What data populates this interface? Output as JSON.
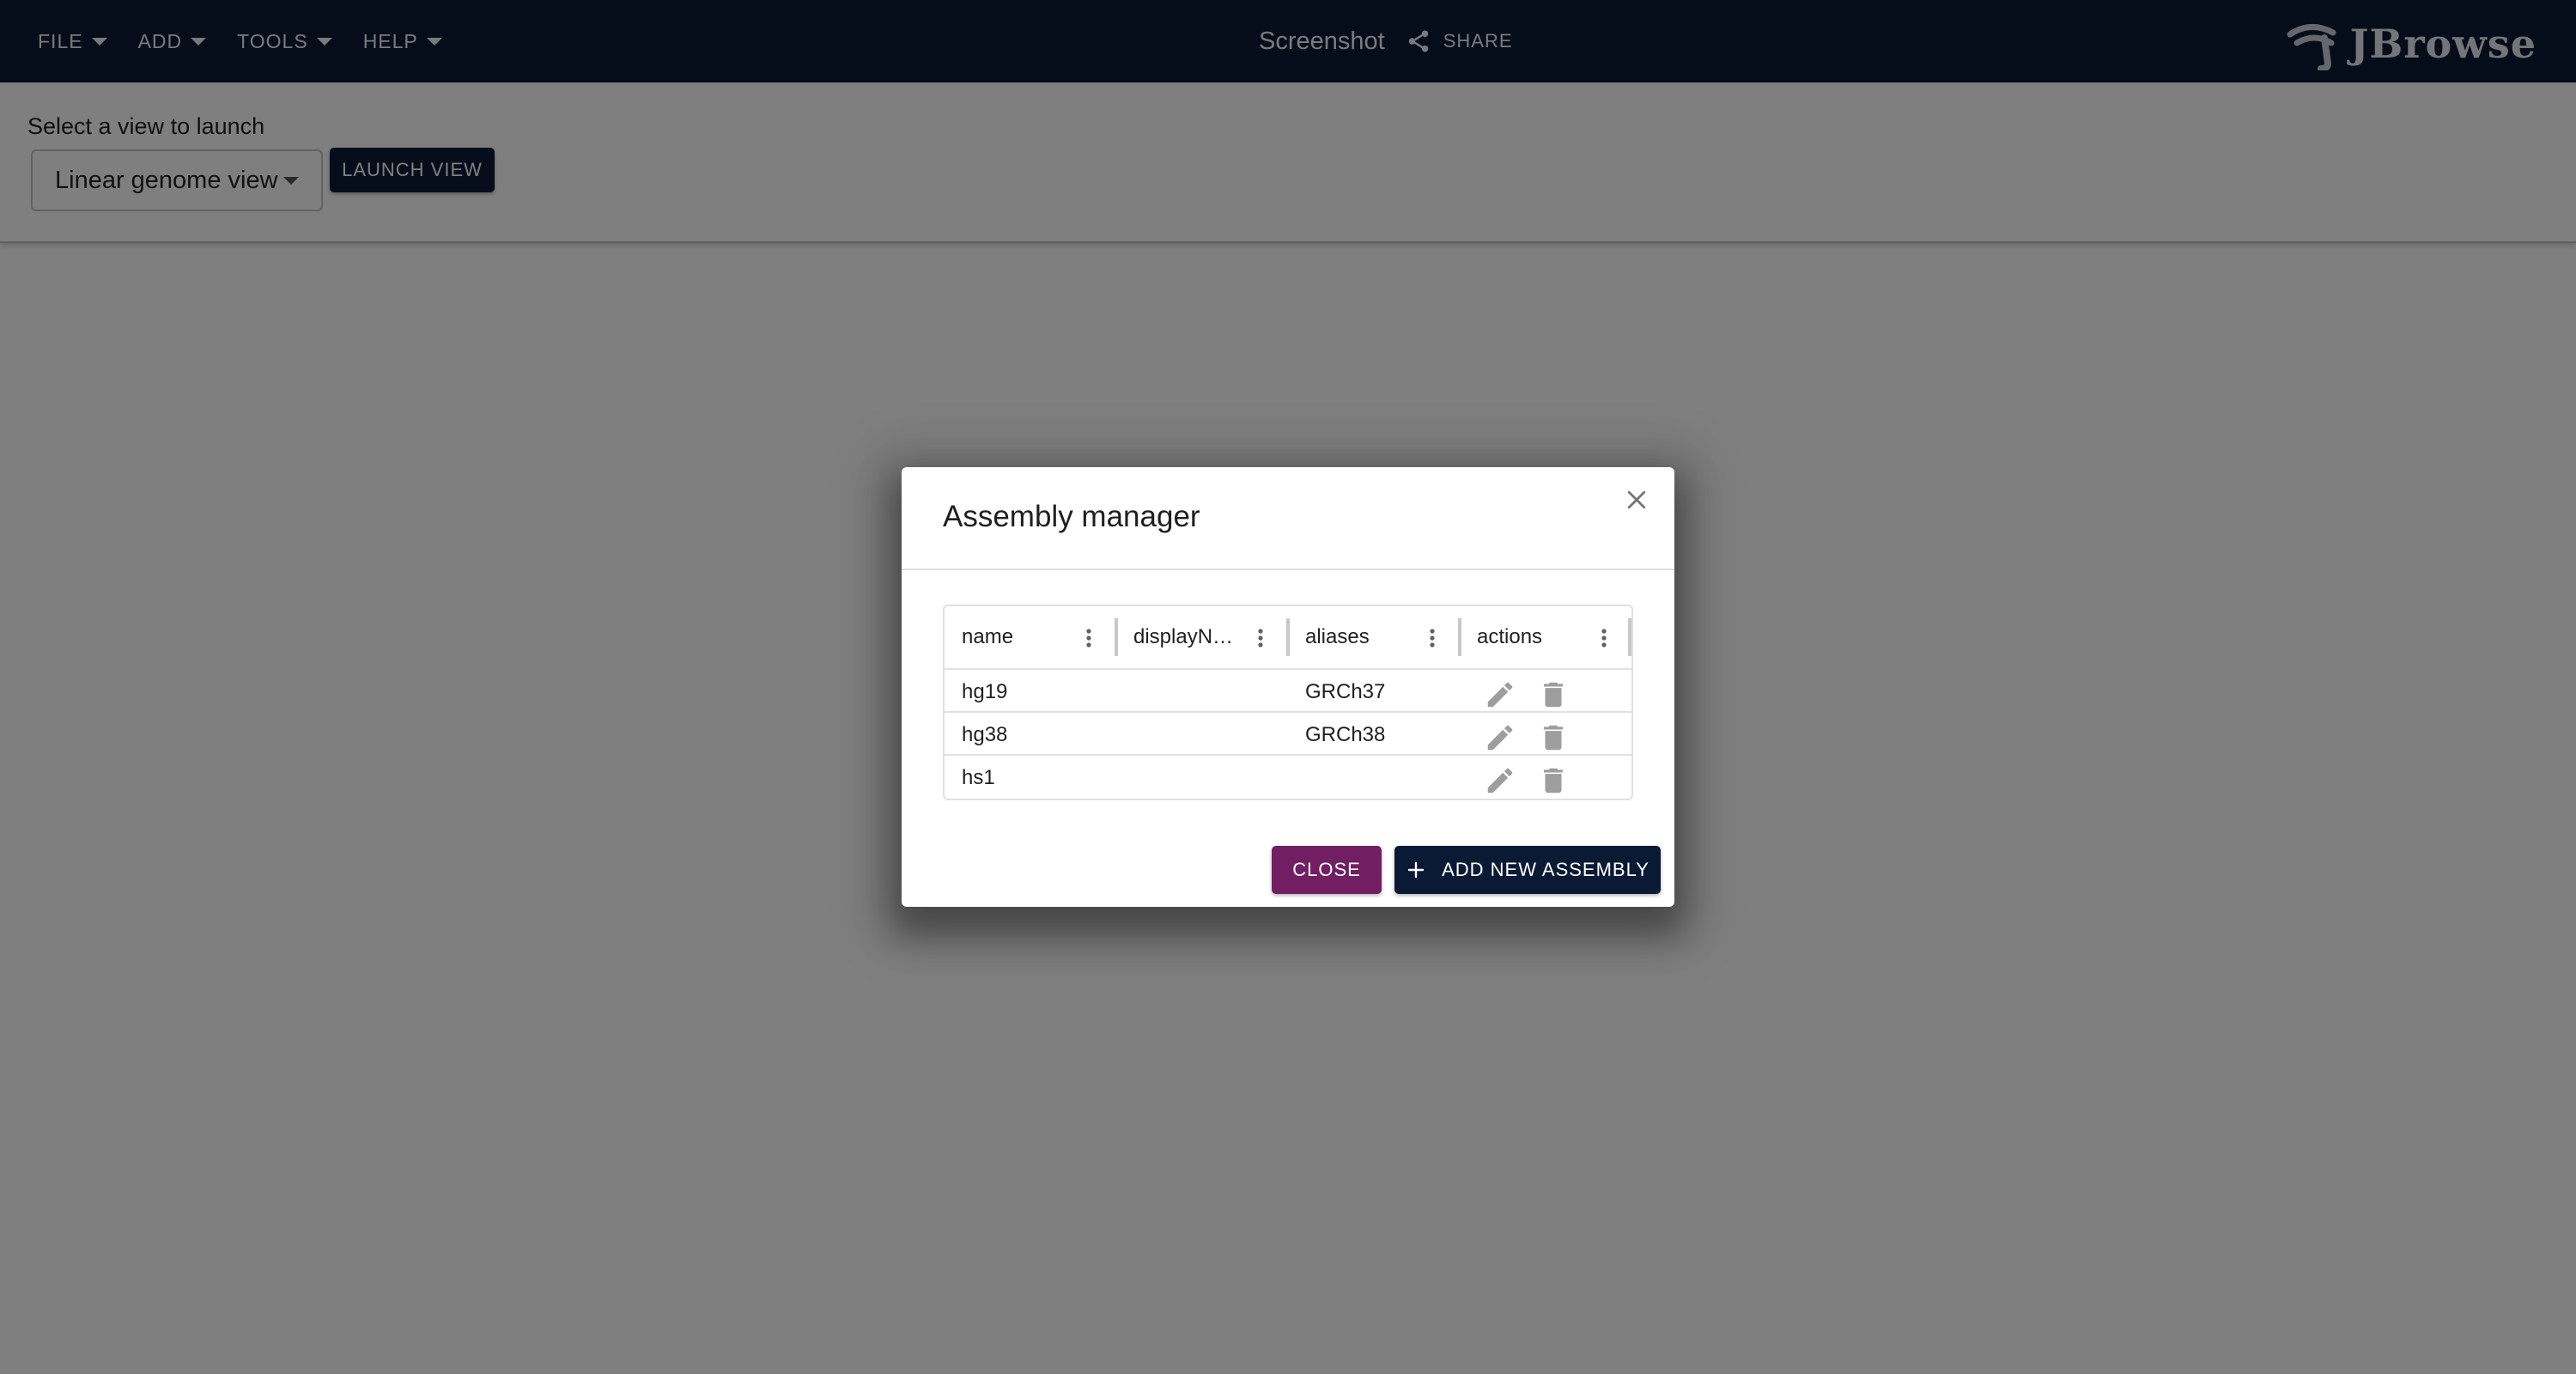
{
  "menu": {
    "items": [
      {
        "label": "FILE"
      },
      {
        "label": "ADD"
      },
      {
        "label": "TOOLS"
      },
      {
        "label": "HELP"
      }
    ]
  },
  "session": {
    "name": "Screenshot",
    "share_label": "SHARE"
  },
  "logo": {
    "text": "JBrowse"
  },
  "launch": {
    "label": "Select a view to launch",
    "selected_view": "Linear genome view",
    "button_label": "LAUNCH VIEW"
  },
  "dialog": {
    "title": "Assembly manager",
    "columns": [
      "name",
      "displayN…",
      "aliases",
      "actions"
    ],
    "rows": [
      {
        "name": "hg19",
        "displayName": "",
        "aliases": "GRCh37"
      },
      {
        "name": "hg38",
        "displayName": "",
        "aliases": "GRCh38"
      },
      {
        "name": "hs1",
        "displayName": "",
        "aliases": ""
      }
    ],
    "close_label": "CLOSE",
    "add_label": "ADD NEW ASSEMBLY"
  },
  "colors": {
    "appbar": "#0a1a35",
    "primary": "#0a1a35",
    "secondary": "#721e63"
  },
  "icons": [
    "chevron-down-icon",
    "share-icon",
    "jbrowse-logo-icon",
    "close-icon",
    "column-menu-icon",
    "edit-icon",
    "delete-icon",
    "plus-icon"
  ]
}
